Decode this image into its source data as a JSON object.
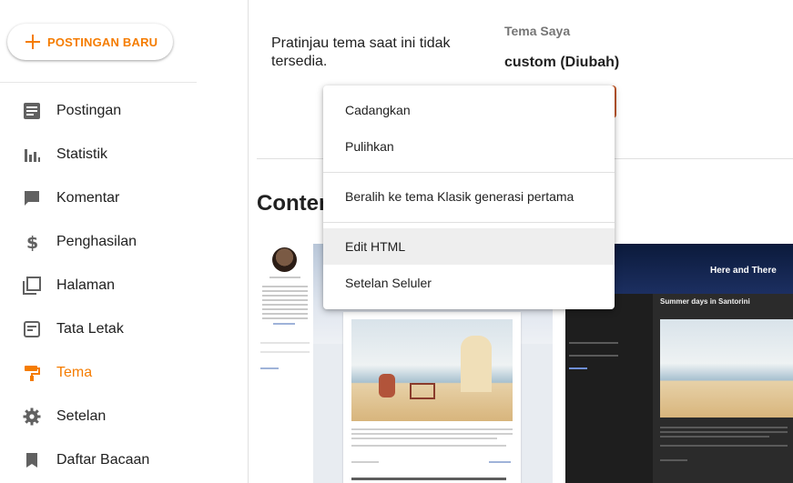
{
  "sidebar": {
    "new_post_label": "POSTINGAN BARU",
    "items": [
      {
        "label": "Postingan",
        "icon": "posts-icon",
        "active": false
      },
      {
        "label": "Statistik",
        "icon": "stats-icon",
        "active": false
      },
      {
        "label": "Komentar",
        "icon": "comment-icon",
        "active": false
      },
      {
        "label": "Penghasilan",
        "icon": "dollar-icon",
        "active": false
      },
      {
        "label": "Halaman",
        "icon": "pages-icon",
        "active": false
      },
      {
        "label": "Tata Letak",
        "icon": "layout-icon",
        "active": false
      },
      {
        "label": "Tema",
        "icon": "paint-roller-icon",
        "active": true
      },
      {
        "label": "Setelan",
        "icon": "gear-icon",
        "active": false
      },
      {
        "label": "Daftar Bacaan",
        "icon": "bookmark-icon",
        "active": false
      }
    ]
  },
  "main": {
    "preview_message": "Pratinjau tema saat ini tidak tersedia.",
    "my_theme_label": "Tema Saya",
    "my_theme_name": "custom (Diubah)",
    "section_title": "Conten",
    "dark_theme_header": "Here and There",
    "dark_post_title": "Summer days in Santorini"
  },
  "menu": {
    "items": [
      {
        "label": "Cadangkan"
      },
      {
        "label": "Pulihkan"
      },
      {
        "label": "Beralih ke tema Klasik generasi pertama"
      },
      {
        "label": "Edit HTML",
        "highlighted": true
      },
      {
        "label": "Setelan Seluler"
      }
    ]
  },
  "colors": {
    "accent": "#f57c00",
    "text": "#212121",
    "muted": "#757575",
    "divider": "#e0e0e0"
  }
}
